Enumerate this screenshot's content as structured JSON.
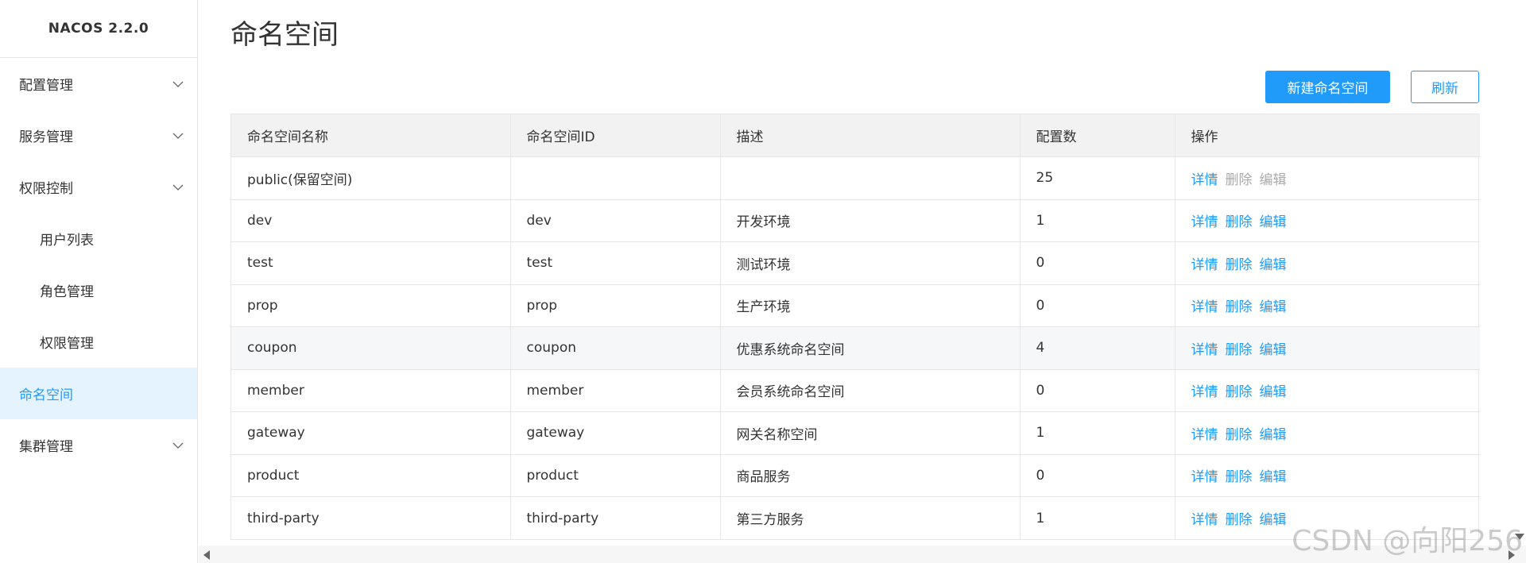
{
  "sidebar": {
    "logo": "NACOS 2.2.0",
    "items": [
      {
        "label": "配置管理",
        "expandable": true
      },
      {
        "label": "服务管理",
        "expandable": true
      },
      {
        "label": "权限控制",
        "expandable": true
      },
      {
        "label": "用户列表",
        "sub": true
      },
      {
        "label": "角色管理",
        "sub": true
      },
      {
        "label": "权限管理",
        "sub": true
      },
      {
        "label": "命名空间",
        "active": true
      },
      {
        "label": "集群管理",
        "expandable": true
      }
    ]
  },
  "main": {
    "title": "命名空间",
    "buttons": {
      "create_label": "新建命名空间",
      "refresh_label": "刷新"
    },
    "table": {
      "columns": [
        "命名空间名称",
        "命名空间ID",
        "描述",
        "配置数",
        "操作"
      ],
      "actions": {
        "detail": "详情",
        "delete": "删除",
        "edit": "编辑"
      },
      "rows": [
        {
          "name": "public(保留空间)",
          "id": "",
          "desc": "",
          "count": "25",
          "reserved": true
        },
        {
          "name": "dev",
          "id": "dev",
          "desc": "开发环境",
          "count": "1"
        },
        {
          "name": "test",
          "id": "test",
          "desc": "测试环境",
          "count": "0"
        },
        {
          "name": "prop",
          "id": "prop",
          "desc": "生产环境",
          "count": "0"
        },
        {
          "name": "coupon",
          "id": "coupon",
          "desc": "优惠系统命名空间",
          "count": "4",
          "hover": true
        },
        {
          "name": "member",
          "id": "member",
          "desc": "会员系统命名空间",
          "count": "0"
        },
        {
          "name": "gateway",
          "id": "gateway",
          "desc": "网关名称空间",
          "count": "1"
        },
        {
          "name": "product",
          "id": "product",
          "desc": "商品服务",
          "count": "0"
        },
        {
          "name": "third-party",
          "id": "third-party",
          "desc": "第三方服务",
          "count": "1"
        }
      ]
    }
  },
  "watermark": "CSDN @向阳256",
  "colors": {
    "accent": "#209bfa",
    "active_bg": "#e4f3fe",
    "header_bg": "#f2f2f2",
    "disabled": "#aaaaaa"
  }
}
